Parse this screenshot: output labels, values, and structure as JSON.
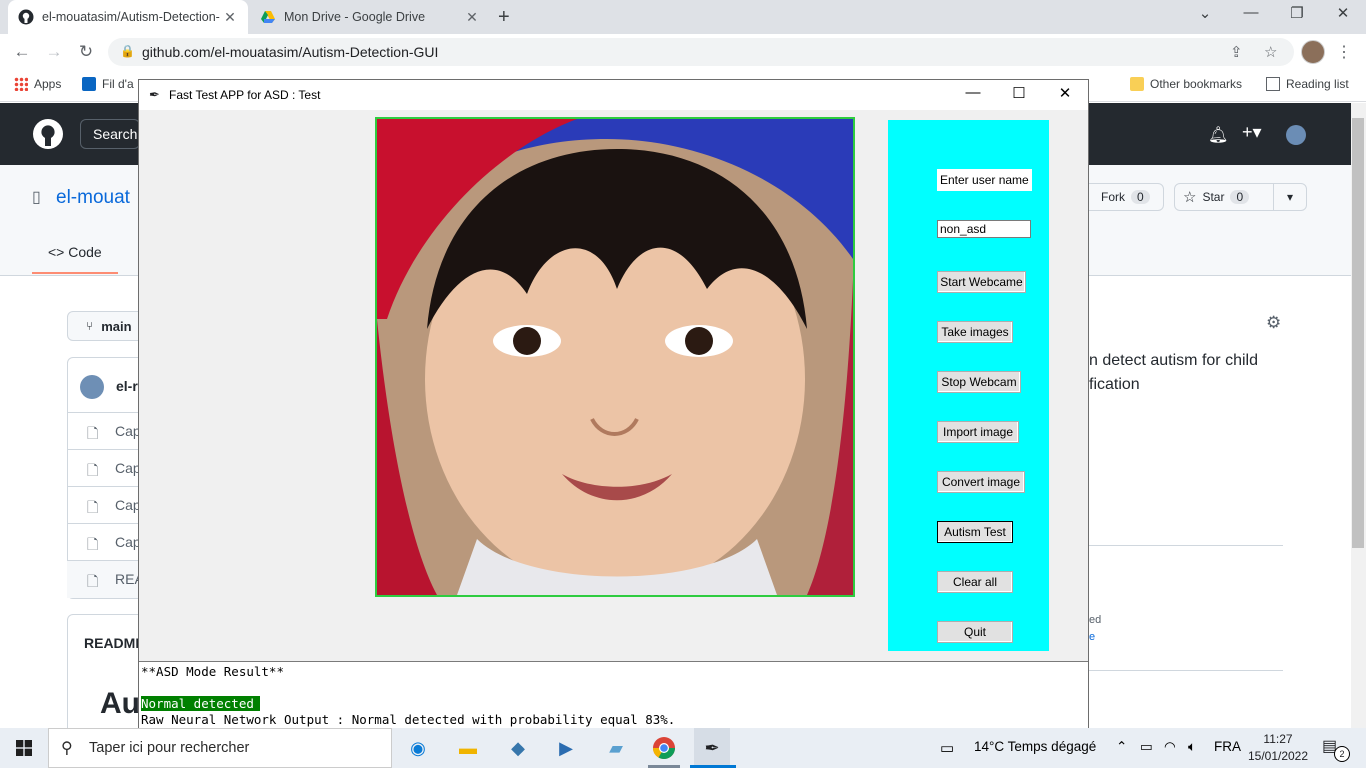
{
  "browser": {
    "tabs": [
      {
        "title": "el-mouatasim/Autism-Detection-",
        "active": true
      },
      {
        "title": "Mon Drive - Google Drive",
        "active": false
      }
    ],
    "url": "github.com/el-mouatasim/Autism-Detection-GUI",
    "bookmarks": {
      "apps": "Apps",
      "linkedin": "Fil d'a",
      "other": "Other bookmarks",
      "reading": "Reading list"
    }
  },
  "github": {
    "search": "Search",
    "repo_owner": "el-mouat",
    "fork_label": "Fork",
    "fork_count": "0",
    "star_label": "Star",
    "star_count": "0",
    "code_tab": "Code",
    "branch": "main",
    "commit_author": "el-r",
    "files": [
      "Cap",
      "Cap",
      "Cap",
      "Cap",
      "REA"
    ],
    "readme_label": "README",
    "readme_heading": "Au",
    "about_line1": "n detect autism for child",
    "about_line2": "fication",
    "side_snip1": "ed",
    "side_snip2": "e"
  },
  "tkapp": {
    "title": "Fast Test APP for ASD :  Test",
    "user_label": "Enter user name",
    "user_value": "non_asd",
    "buttons": {
      "start_webcam": "Start Webcame",
      "take_images": "Take images",
      "stop_webcam": "Stop Webcam",
      "import_image": "Import image",
      "convert_image": "Convert image",
      "autism_test": "Autism Test",
      "clear_all": "Clear all",
      "quit": "Quit"
    },
    "output": {
      "header": "**ASD Mode Result**",
      "result": "Normal detected",
      "raw": "Raw Neural Network Output : Normal detected with probability equal 83%."
    },
    "colors": {
      "panel": "#00ffff",
      "photo_border": "#2ecc40",
      "result_bg": "#008000"
    }
  },
  "taskbar": {
    "search_placeholder": "Taper ici pour rechercher",
    "weather": "14°C  Temps dégagé",
    "lang": "FRA",
    "time": "11:27",
    "date": "15/01/2022",
    "notif_count": "2"
  }
}
